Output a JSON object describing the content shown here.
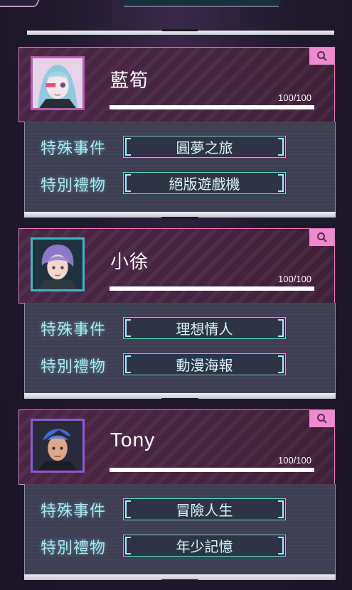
{
  "labels": {
    "event_label": "特殊事件",
    "gift_label": "特別禮物"
  },
  "characters": [
    {
      "name": "藍筍",
      "progress_text": "100/100",
      "progress": 1.0,
      "special_event": "圓夢之旅",
      "special_gift": "絕版遊戲機",
      "avatar_color": "#b55cb0"
    },
    {
      "name": "小徐",
      "progress_text": "100/100",
      "progress": 1.0,
      "special_event": "理想情人",
      "special_gift": "動漫海報",
      "avatar_color": "#3fb6c3"
    },
    {
      "name": "Tony",
      "progress_text": "100/100",
      "progress": 1.0,
      "special_event": "冒險人生",
      "special_gift": "年少記憶",
      "avatar_color": "#8c5ad6"
    }
  ],
  "colors": {
    "accent_pink": "#f08ad0",
    "accent_cyan": "#69d2dc",
    "label_cyan": "#a8eaf2"
  },
  "icons": [
    "search-icon"
  ]
}
